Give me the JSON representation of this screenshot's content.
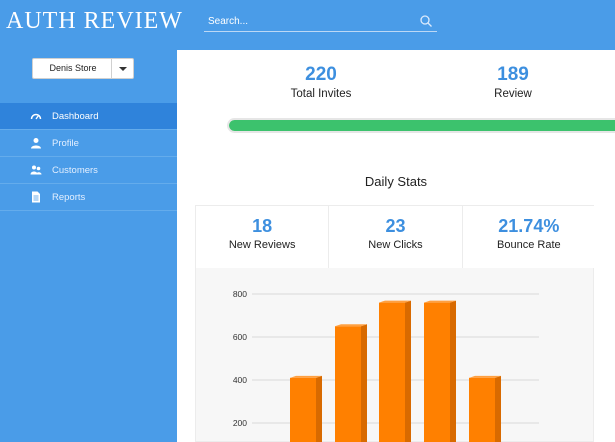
{
  "header": {
    "brand": "AUTH REVIEW",
    "search_placeholder": "Search..."
  },
  "sidebar": {
    "store": "Denis Store",
    "items": [
      {
        "label": "Dashboard",
        "icon": "speedometer-icon",
        "active": true
      },
      {
        "label": "Profile",
        "icon": "user-icon",
        "active": false
      },
      {
        "label": "Customers",
        "icon": "users-icon",
        "active": false
      },
      {
        "label": "Reports",
        "icon": "document-icon",
        "active": false
      }
    ]
  },
  "summary": {
    "invites_value": "220",
    "invites_label": "Total Invites",
    "review_value": "189",
    "review_label": "Review",
    "progress_fraction": 1.0
  },
  "daily": {
    "title": "Daily Stats",
    "new_reviews_value": "18",
    "new_reviews_label": "New Reviews",
    "new_clicks_value": "23",
    "new_clicks_label": "New Clicks",
    "bounce_value": "21.74%",
    "bounce_label": "Bounce Rate"
  },
  "colors": {
    "brand_blue": "#4a9ce8",
    "active_blue": "#2f83db",
    "value_blue": "#3d8fdf",
    "progress_green": "#3cc26d",
    "bar_orange": "#ff8000",
    "bar_orange_side": "#d86a00",
    "bar_orange_top": "#ffa040"
  },
  "chart_data": {
    "type": "bar",
    "categories": [
      "",
      "",
      "",
      "",
      ""
    ],
    "values": [
      410,
      650,
      760,
      760,
      410
    ],
    "yticks": [
      200,
      400,
      600,
      800
    ],
    "ylim": [
      0,
      800
    ],
    "grid": true,
    "title": "",
    "xlabel": "",
    "ylabel": ""
  }
}
